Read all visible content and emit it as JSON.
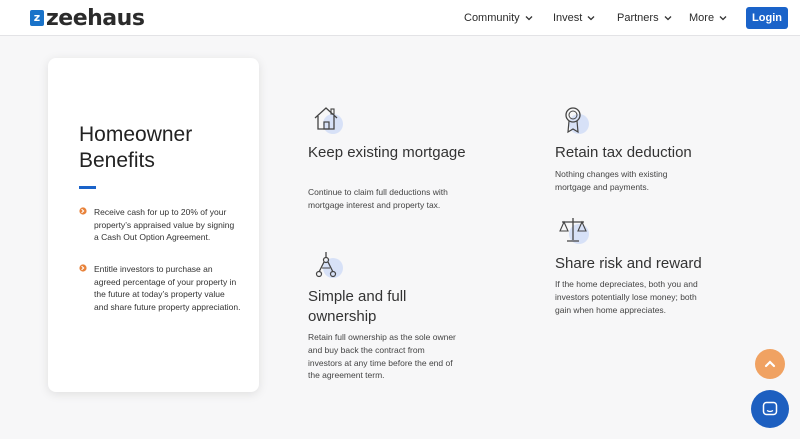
{
  "header": {
    "logo_text": "zeehaus",
    "logo_mark": "z",
    "nav": [
      {
        "label": "Community"
      },
      {
        "label": "Invest"
      },
      {
        "label": "Partners"
      },
      {
        "label": "More"
      }
    ],
    "login_label": "Login"
  },
  "benefits_card": {
    "title_line1": "Homeowner",
    "title_line2": "Benefits",
    "bullets": [
      {
        "text": "Receive cash for up to 20% of your property’s appraised value by signing a Cash Out Option Agreement."
      },
      {
        "text": "Entitle investors to purchase an agreed percentage of your property in the future at today’s property value and share future property appreciation."
      }
    ]
  },
  "features": [
    {
      "icon": "house-icon",
      "title": "Keep existing mortgage",
      "description": "Continue to claim full deductions with mortgage interest and property tax."
    },
    {
      "icon": "award-ribbon-icon",
      "title": "Retain tax deduction",
      "description": "Nothing changes with existing mortgage and payments."
    },
    {
      "icon": "clamp-icon",
      "title": "Simple and full ownership",
      "description": "Retain full ownership as the sole owner and buy back the contract from investors at any time before the end of the agreement term."
    },
    {
      "icon": "balance-scale-icon",
      "title": "Share risk and reward",
      "description": "If the home depreciates, both you and investors potentially lose money; both gain when home appreciates."
    }
  ],
  "colors": {
    "brand_blue": "#1a63c9",
    "accent_orange": "#e8823a",
    "scroll_top_button": "#f0a262",
    "chat_button": "#1d5fc0"
  }
}
